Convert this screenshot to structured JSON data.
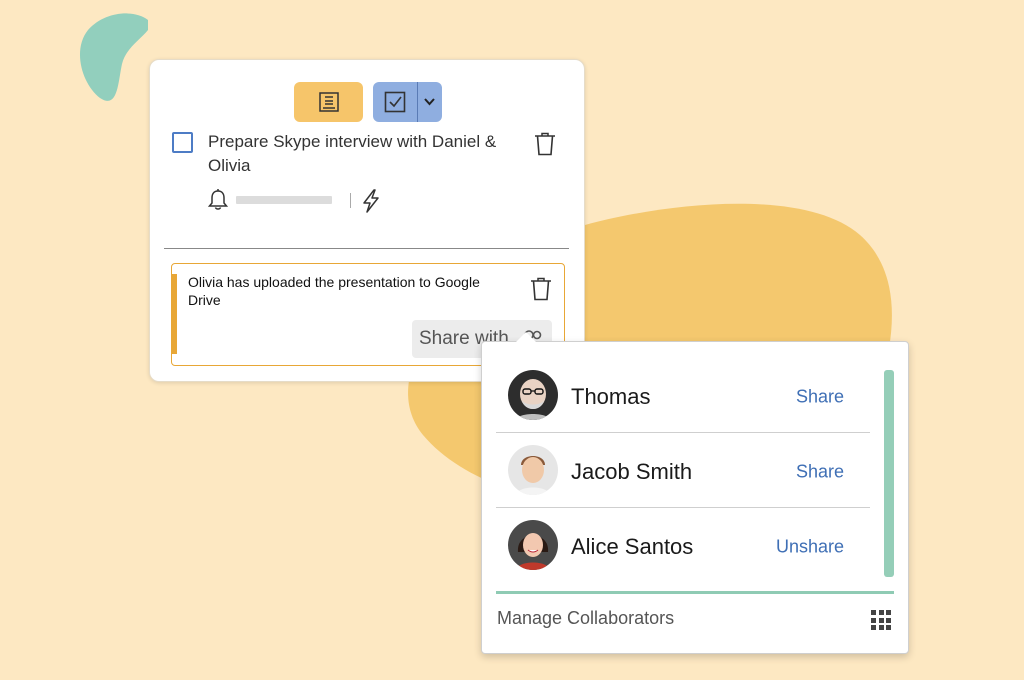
{
  "colors": {
    "background": "#fde8c2",
    "teal_blob": "#92cfbd",
    "yellow_blob": "#f4c86e",
    "text_type_button": "#f6c56a",
    "checklist_type_button": "#8faee0",
    "comment_accent": "#e8a736",
    "link_blue": "#3f6fb5",
    "scrollbar": "#95ceb8"
  },
  "note": {
    "task_text": "Prepare Skype interview with Daniel & Olivia",
    "task_checked": false,
    "comment_text": "Olivia has uploaded the presentation to Google Drive",
    "share_with_label": "Share with",
    "icons": [
      "text-note-icon",
      "checklist-icon",
      "chevron-down-icon",
      "trash-icon",
      "bell-icon",
      "lightning-icon",
      "people-icon"
    ]
  },
  "share_popup": {
    "collaborators": [
      {
        "name": "Thomas",
        "action": "Share"
      },
      {
        "name": "Jacob Smith",
        "action": "Share"
      },
      {
        "name": "Alice Santos",
        "action": "Unshare"
      }
    ],
    "manage_label": "Manage Collaborators",
    "icons": [
      "grid-icon"
    ]
  }
}
